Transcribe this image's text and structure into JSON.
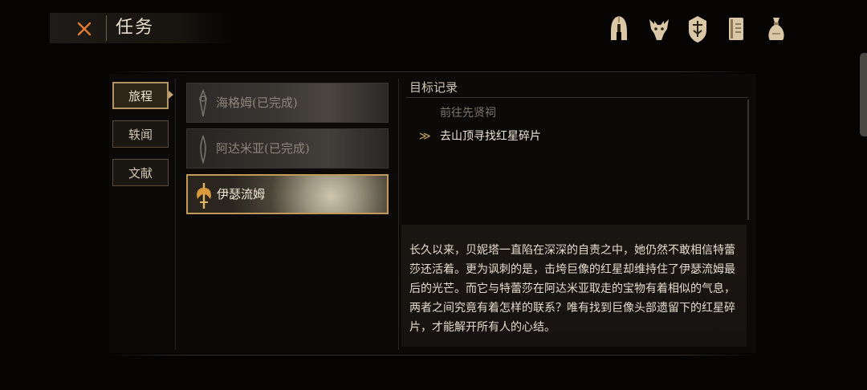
{
  "header": {
    "title": "任务",
    "close_icon": "close-x-icon",
    "accent": "#e2792e"
  },
  "top_icons": [
    {
      "name": "helmet-icon"
    },
    {
      "name": "beast-skull-icon"
    },
    {
      "name": "shield-emblem-icon"
    },
    {
      "name": "journal-icon"
    },
    {
      "name": "item-bag-icon"
    }
  ],
  "tabs": [
    {
      "label": "旅程",
      "active": true
    },
    {
      "label": "轶闻",
      "active": false
    },
    {
      "label": "文献",
      "active": false
    }
  ],
  "quests": [
    {
      "label": "海格姆(已完成)",
      "completed": true,
      "active": false
    },
    {
      "label": "阿达米亚(已完成)",
      "completed": true,
      "active": false
    },
    {
      "label": "伊瑟流姆",
      "completed": false,
      "active": true
    }
  ],
  "objectives": {
    "title": "目标记录",
    "items": [
      {
        "text": "前往先贤祠",
        "done": true
      },
      {
        "text": "去山顶寻找红星碎片",
        "done": false
      }
    ],
    "current_marker": "≫"
  },
  "description": "长久以来，贝妮塔一直陷在深深的自责之中，她仍然不敢相信特蕾莎还活着。更为讽刺的是，击垮巨像的红星却维持住了伊瑟流姆最后的光芒。而它与特蕾莎在阿达米亚取走的宝物有着相似的气息，两者之间究竟有着怎样的联系？唯有找到巨像头部遗留下的红星碎片，才能解开所有人的心结。",
  "colors": {
    "gold": "#c29a57",
    "background": "#050403"
  }
}
